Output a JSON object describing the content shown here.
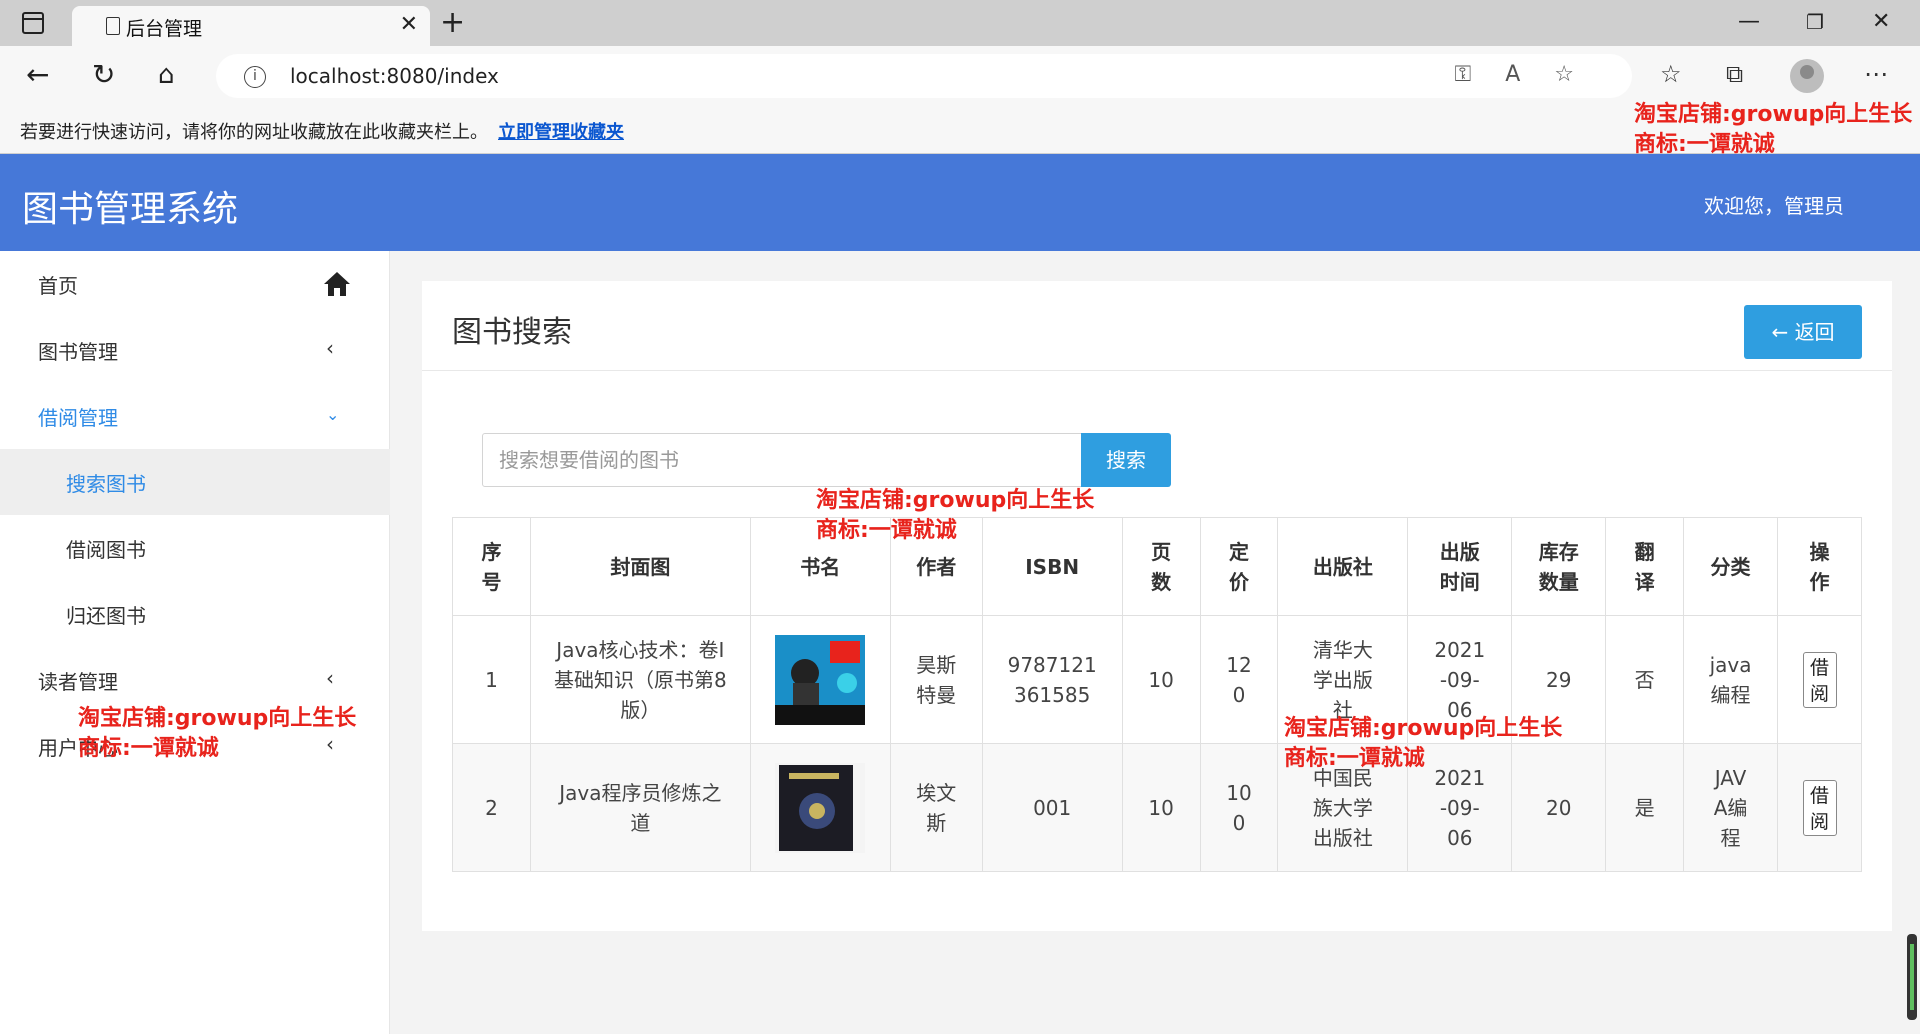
{
  "browser": {
    "tab_title": "后台管理",
    "url": "localhost:8080/index",
    "favorites_hint": "若要进行快速访问，请将你的网址收藏放在此收藏夹栏上。",
    "favorites_link": "立即管理收藏夹"
  },
  "header": {
    "app_title": "图书管理系统",
    "welcome": "欢迎您，管理员"
  },
  "sidebar": {
    "items": [
      {
        "label": "首页"
      },
      {
        "label": "图书管理"
      },
      {
        "label": "借阅管理"
      },
      {
        "label": "搜索图书"
      },
      {
        "label": "借阅图书"
      },
      {
        "label": "归还图书"
      },
      {
        "label": "读者管理"
      },
      {
        "label": "用户中心"
      }
    ]
  },
  "main": {
    "title": "图书搜索",
    "back_label": "返回",
    "search_placeholder": "搜索想要借阅的图书",
    "search_button": "搜索",
    "columns": [
      "序号",
      "封面图",
      "书名",
      "作者",
      "ISBN",
      "页数",
      "定价",
      "出版社",
      "出版时间",
      "库存数量",
      "翻译",
      "分类",
      "操作"
    ],
    "rows": [
      {
        "no": "1",
        "title": "Java核心技术：卷Ⅰ基础知识（原书第8版）",
        "author": "昊斯特曼",
        "isbn": "9787121361585",
        "pages": "10",
        "price": "120",
        "publisher": "清华大学出版社",
        "date": "2021-09-06",
        "stock": "29",
        "translated": "否",
        "category": "java编程",
        "action": "借阅"
      },
      {
        "no": "2",
        "title": "Java程序员修炼之道",
        "author": "埃文斯",
        "isbn": "001",
        "pages": "10",
        "price": "100",
        "publisher": "中国民族大学出版社",
        "date": "2021-09-06",
        "stock": "20",
        "translated": "是",
        "category": "JAVA编程",
        "action": "借阅"
      }
    ]
  },
  "watermarks": [
    {
      "line1": "淘宝店铺:growup向上生长",
      "line2": "商标:一谭就诚"
    },
    {
      "line1": "淘宝店铺:growup向上生长",
      "line2": "商标:一谭就诚"
    },
    {
      "line1": "淘宝店铺:growup向上生长",
      "line2": "商标:一谭就诚"
    },
    {
      "line1": "淘宝店铺:growup向上生长",
      "line2": "商标:一谭就诚"
    }
  ],
  "colors": {
    "header": "#4678d8",
    "accent": "#2f9ee0",
    "watermark": "#e8231c"
  }
}
